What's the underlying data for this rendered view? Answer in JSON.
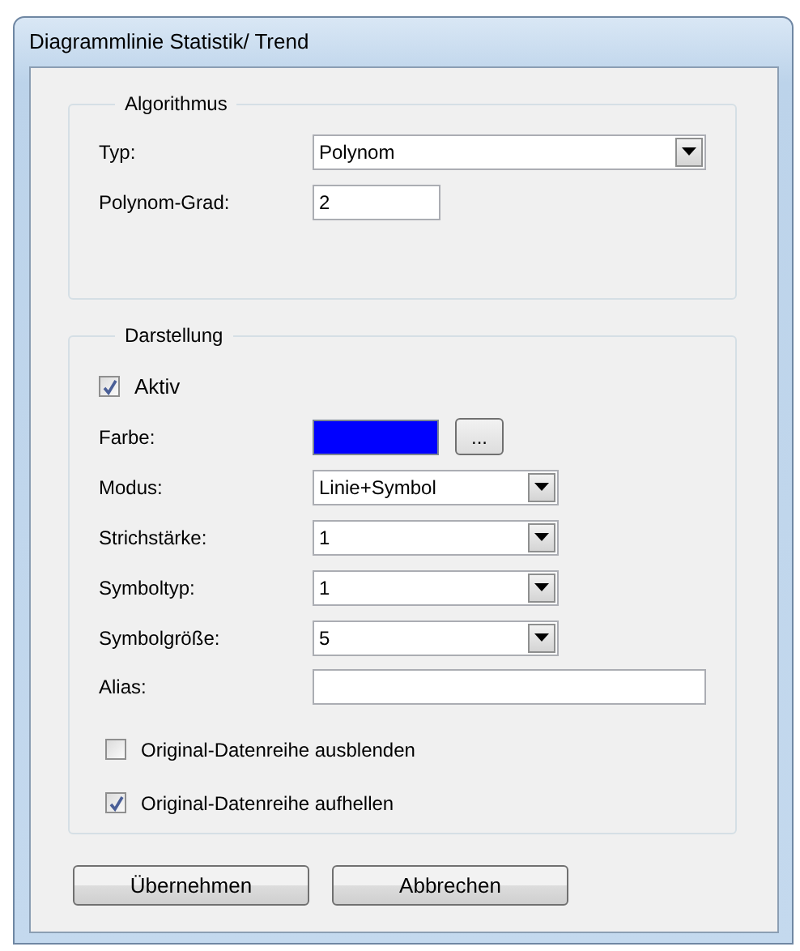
{
  "window": {
    "title": "Diagrammlinie Statistik/ Trend"
  },
  "groups": [
    {
      "title": "Algorithmus",
      "fields": [
        {
          "kind": "select",
          "label": "Typ:",
          "value": "Polynom"
        },
        {
          "kind": "number",
          "label": "Polynom-Grad:",
          "value": "2"
        }
      ]
    },
    {
      "title": "Darstellung",
      "fields": [
        {
          "kind": "checkbox",
          "label": "Aktiv",
          "checked": true
        },
        {
          "kind": "color",
          "label": "Farbe:",
          "color": "#0000ff",
          "button": "..."
        },
        {
          "kind": "select",
          "label": "Modus:",
          "value": "Linie+Symbol"
        },
        {
          "kind": "select",
          "label": "Strichstärke:",
          "value": "1"
        },
        {
          "kind": "select",
          "label": "Symboltyp:",
          "value": "1"
        },
        {
          "kind": "select",
          "label": "Symbolgröße:",
          "value": "5"
        },
        {
          "kind": "text",
          "label": "Alias:"
        },
        {
          "kind": "option",
          "label": "Original-Datenreihe ausblenden",
          "checked": false
        },
        {
          "kind": "option",
          "label": "Original-Datenreihe aufhellen",
          "checked": true
        }
      ]
    }
  ],
  "buttons": [
    "Übernehmen",
    "Abbrechen"
  ]
}
